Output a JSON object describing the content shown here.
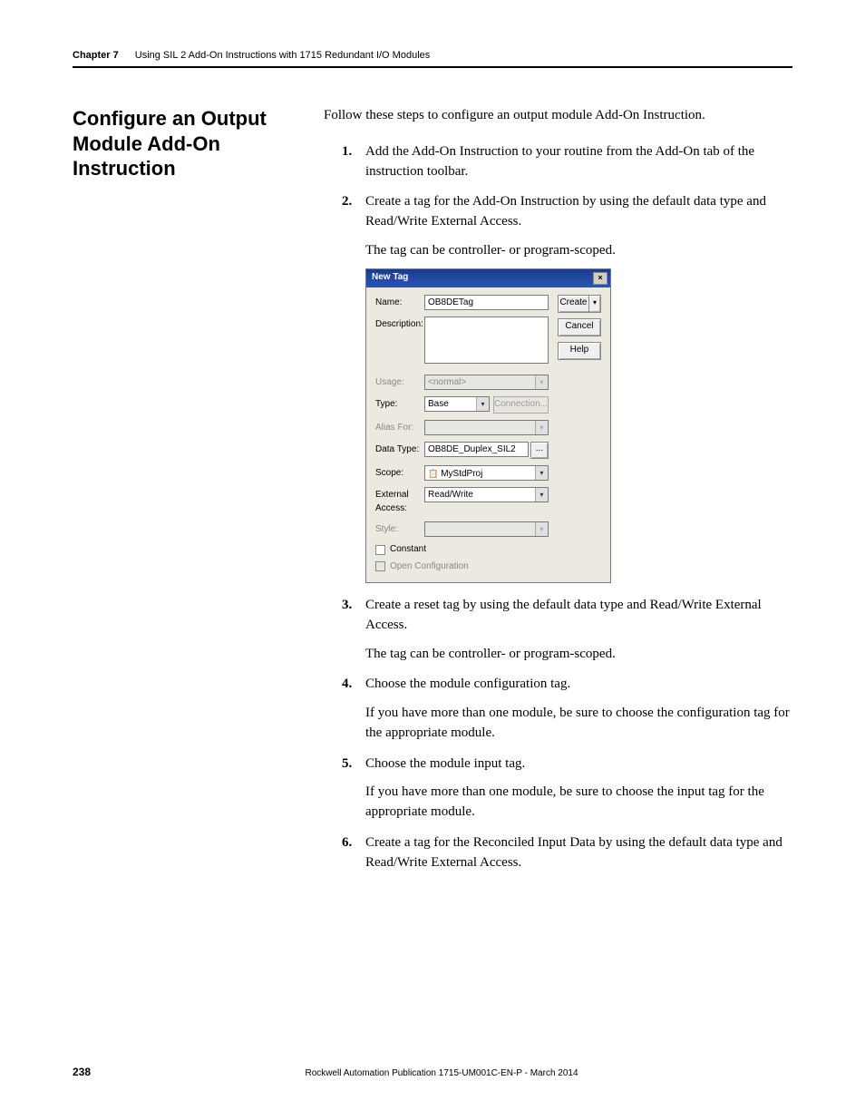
{
  "header": {
    "chapter_label": "Chapter 7",
    "chapter_title": "Using SIL 2 Add-On Instructions with 1715 Redundant I/O Modules"
  },
  "section_heading": "Configure an Output Module Add-On Instruction",
  "intro": "Follow these steps to configure an output module Add-On Instruction.",
  "steps": [
    {
      "text": "Add the Add-On Instruction to your routine from the Add-On tab of the instruction toolbar."
    },
    {
      "text": "Create a tag for the Add-On Instruction by using the default data type and Read/Write External Access.",
      "note": "The tag can be controller- or program-scoped."
    },
    {
      "text": "Create a reset tag by using the default data type and Read/Write External Access.",
      "note": "The tag can be controller- or program-scoped."
    },
    {
      "text": "Choose the module configuration tag.",
      "note": "If you have more than one module, be sure to choose the configuration tag for the appropriate module."
    },
    {
      "text": "Choose the module input tag.",
      "note": "If you have more than one module, be sure to choose the input tag for the appropriate module."
    },
    {
      "text": "Create a tag for the Reconciled Input Data by using the default data type and Read/Write External Access."
    }
  ],
  "dialog": {
    "title": "New Tag",
    "buttons": {
      "create": "Create",
      "cancel": "Cancel",
      "help": "Help"
    },
    "labels": {
      "name": "Name:",
      "description": "Description:",
      "usage": "Usage:",
      "type": "Type:",
      "alias_for": "Alias For:",
      "data_type": "Data Type:",
      "scope": "Scope:",
      "external_access": "External Access:",
      "style": "Style:",
      "constant": "Constant",
      "open_config": "Open Configuration"
    },
    "values": {
      "name": "OB8DETag",
      "description": "",
      "usage": "<normal>",
      "type": "Base",
      "connection": "Connection...",
      "alias_for": "",
      "data_type": "OB8DE_Duplex_SIL2",
      "browse": "...",
      "scope": "MyStdProj",
      "external_access": "Read/Write",
      "style": ""
    }
  },
  "footer": {
    "page_number": "238",
    "publication": "Rockwell Automation Publication 1715-UM001C-EN-P - March 2014"
  }
}
